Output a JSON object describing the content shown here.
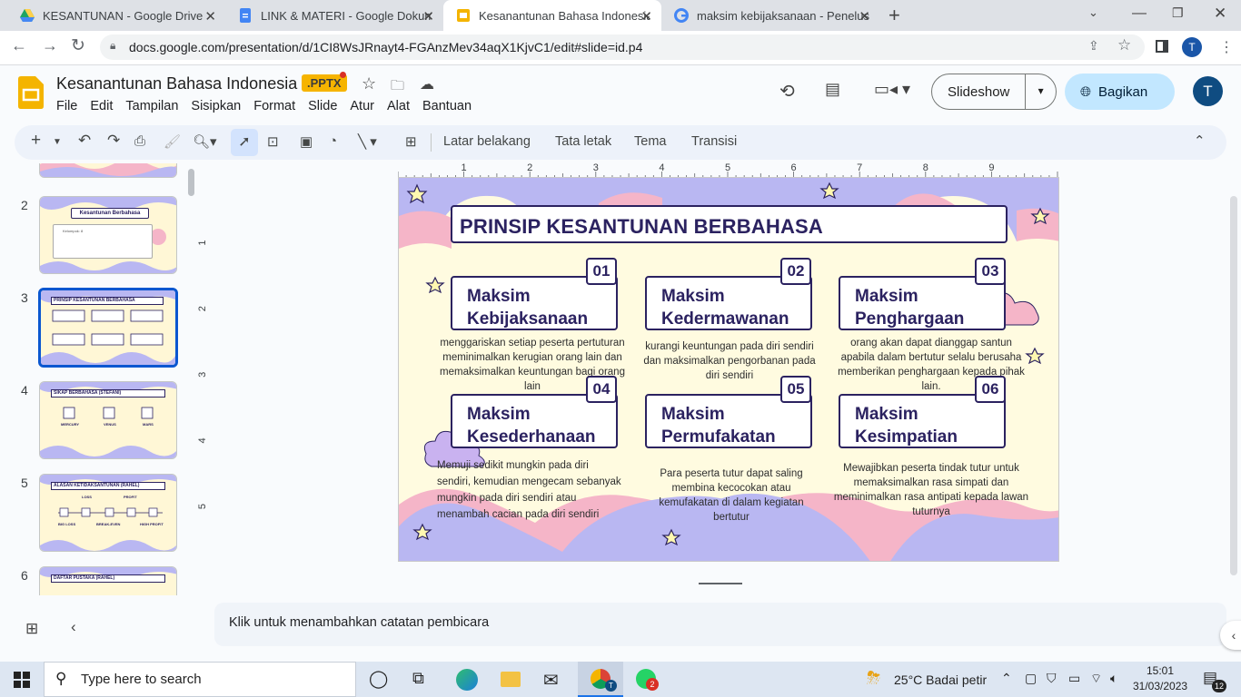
{
  "browser": {
    "tabs": [
      {
        "label": "KESANTUNAN - Google Drive",
        "icon": "google-drive-icon"
      },
      {
        "label": "LINK & MATERI - Google Dokumen",
        "icon": "google-docs-icon"
      },
      {
        "label": "Kesanantunan Bahasa Indonesia - Google Slides",
        "icon": "google-slides-icon"
      },
      {
        "label": "maksim kebijaksanaan - Penelusuran",
        "icon": "google-g-icon"
      }
    ],
    "url": "docs.google.com/presentation/d/1CI8WsJRnayt4-FGAnzMev34aqX1KjvC1/edit#slide=id.p4",
    "profile": "T"
  },
  "doc": {
    "title": "Kesanantunan Bahasa Indonesia",
    "badge": ".PPTX",
    "menu": [
      "File",
      "Edit",
      "Tampilan",
      "Sisipkan",
      "Format",
      "Slide",
      "Atur",
      "Alat",
      "Bantuan"
    ],
    "slideshow": "Slideshow",
    "share": "Bagikan",
    "avatar": "T"
  },
  "toolbar": {
    "items": [
      "Latar belakang",
      "Tata letak",
      "Tema",
      "Transisi"
    ]
  },
  "ruler": [
    "1",
    "2",
    "3",
    "4",
    "5",
    "6",
    "7",
    "8",
    "9"
  ],
  "vruler": [
    "1",
    "2",
    "3",
    "4",
    "5"
  ],
  "filmstrip": [
    {
      "num": "2",
      "title": "Kesantunan Berbahasa",
      "sub": "Kelompok: 8"
    },
    {
      "num": "3",
      "title": "PRINSIP KESANTUNAN BERBAHASA"
    },
    {
      "num": "4",
      "title": "SIKAP BERBAHASA (STEFANI)",
      "labels": [
        "MERCURY",
        "VENUS",
        "MARS"
      ]
    },
    {
      "num": "5",
      "title": "ALASAN KETIDAKSANTUNAN (RAHEL)",
      "labels": [
        "LOSS",
        "PROFIT",
        "BIG LOSS",
        "BREAK-EVEN",
        "HIGH PROFIT"
      ]
    },
    {
      "num": "6",
      "title": "DAFTAR PUSTAKA (RAHEL)"
    }
  ],
  "slide": {
    "title": "PRINSIP KESANTUNAN BERBAHASA",
    "cards": [
      {
        "num": "01",
        "l1": "Maksim",
        "l2": "Kebijaksanaan",
        "desc": "menggariskan setiap peserta pertuturan meminimalkan kerugian orang lain dan memaksimalkan keuntungan bagi orang lain"
      },
      {
        "num": "02",
        "l1": "Maksim",
        "l2": "Kedermawanan",
        "desc": "kurangi keuntungan pada diri sendiri dan maksimalkan pengorbanan pada diri sendiri"
      },
      {
        "num": "03",
        "l1": "Maksim",
        "l2": "Penghargaan",
        "desc": "orang akan dapat dianggap santun apabila dalam bertutur selalu berusaha memberikan penghargaan kepada pihak lain."
      },
      {
        "num": "04",
        "l1": "Maksim",
        "l2": "Kesederhanaan",
        "desc": "Memuji sedikit mungkin pada diri sendiri, kemudian mengecam sebanyak mungkin pada diri sendiri atau menambah cacian pada diri sendiri"
      },
      {
        "num": "05",
        "l1": "Maksim",
        "l2": "Permufakatan",
        "desc": "Para peserta tutur dapat saling membina kecocokan atau kemufakatan di dalam kegiatan bertutur"
      },
      {
        "num": "06",
        "l1": "Maksim",
        "l2": "Kesimpatian",
        "desc": "Mewajibkan peserta tindak tutur untuk memaksimalkan rasa simpati dan meminimalkan rasa antipati kepada lawan tuturnya"
      }
    ]
  },
  "notes": "Klik untuk menambahkan catatan pembicara",
  "taskbar": {
    "search": "Type here to search",
    "weather": "25°C  Badai petir",
    "time": "15:01",
    "date": "31/03/2023",
    "notif": "12",
    "chrome_badge": "T",
    "whatsapp_badge": "2"
  },
  "colors": {
    "accent": "#0b57d0",
    "slideNavy": "#2b2260",
    "lavender": "#b9b7f2",
    "pink": "#f5b5c8",
    "cream": "#fffbe0"
  }
}
